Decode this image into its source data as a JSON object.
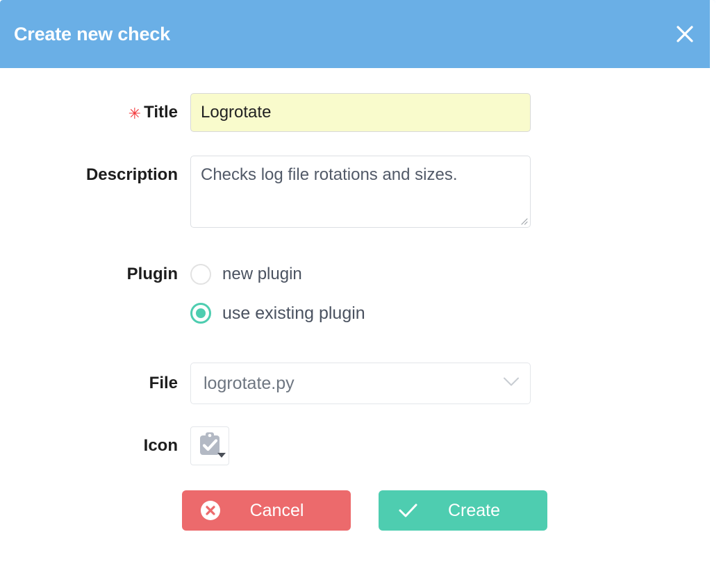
{
  "dialog": {
    "title": "Create new check",
    "close_icon": "close-icon",
    "header_color": "#6AAFE6"
  },
  "form": {
    "title_field": {
      "label": "Title",
      "required_marker": "✳",
      "value": "Logrotate",
      "placeholder": "",
      "background_color": "#F9FBCC"
    },
    "description_field": {
      "label": "Description",
      "value": "Checks log file rotations and sizes.",
      "placeholder": ""
    },
    "plugin_field": {
      "label": "Plugin",
      "options": [
        {
          "label": "new plugin",
          "selected": false
        },
        {
          "label": "use existing plugin",
          "selected": true
        }
      ],
      "accent_color": "#4ECDB0"
    },
    "file_field": {
      "label": "File",
      "value": "logrotate.py",
      "chevron_icon": "chevron-down-icon"
    },
    "icon_field": {
      "label": "Icon",
      "icon_name": "clipboard-check-icon",
      "caret_icon": "caret-down-icon"
    }
  },
  "footer": {
    "cancel": {
      "label": "Cancel",
      "icon": "circle-x-icon",
      "color": "#EC6A6C"
    },
    "create": {
      "label": "Create",
      "icon": "check-icon",
      "color": "#4ECDB0"
    }
  }
}
